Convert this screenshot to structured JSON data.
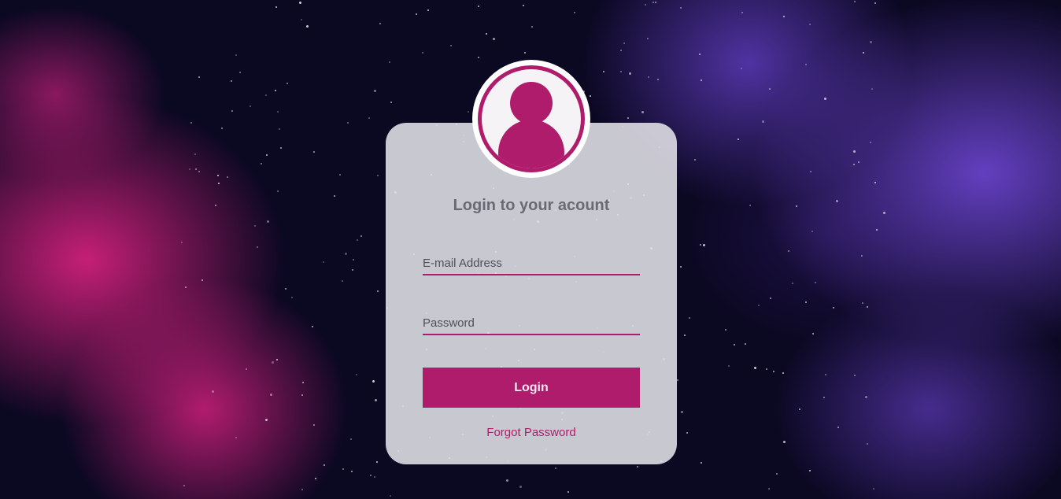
{
  "login": {
    "title": "Login to your acount",
    "email_placeholder": "E-mail Address",
    "password_placeholder": "Password",
    "login_label": "Login",
    "forgot_label": "Forgot Password"
  },
  "theme": {
    "accent": "#b01c6c",
    "card_bg": "#e2e2e8",
    "title_color": "#6a6a74",
    "background_dark": "#0b0822",
    "background_pink": "#d0207a",
    "background_purple": "#6842c8"
  },
  "icons": {
    "avatar": "user-avatar-icon"
  }
}
